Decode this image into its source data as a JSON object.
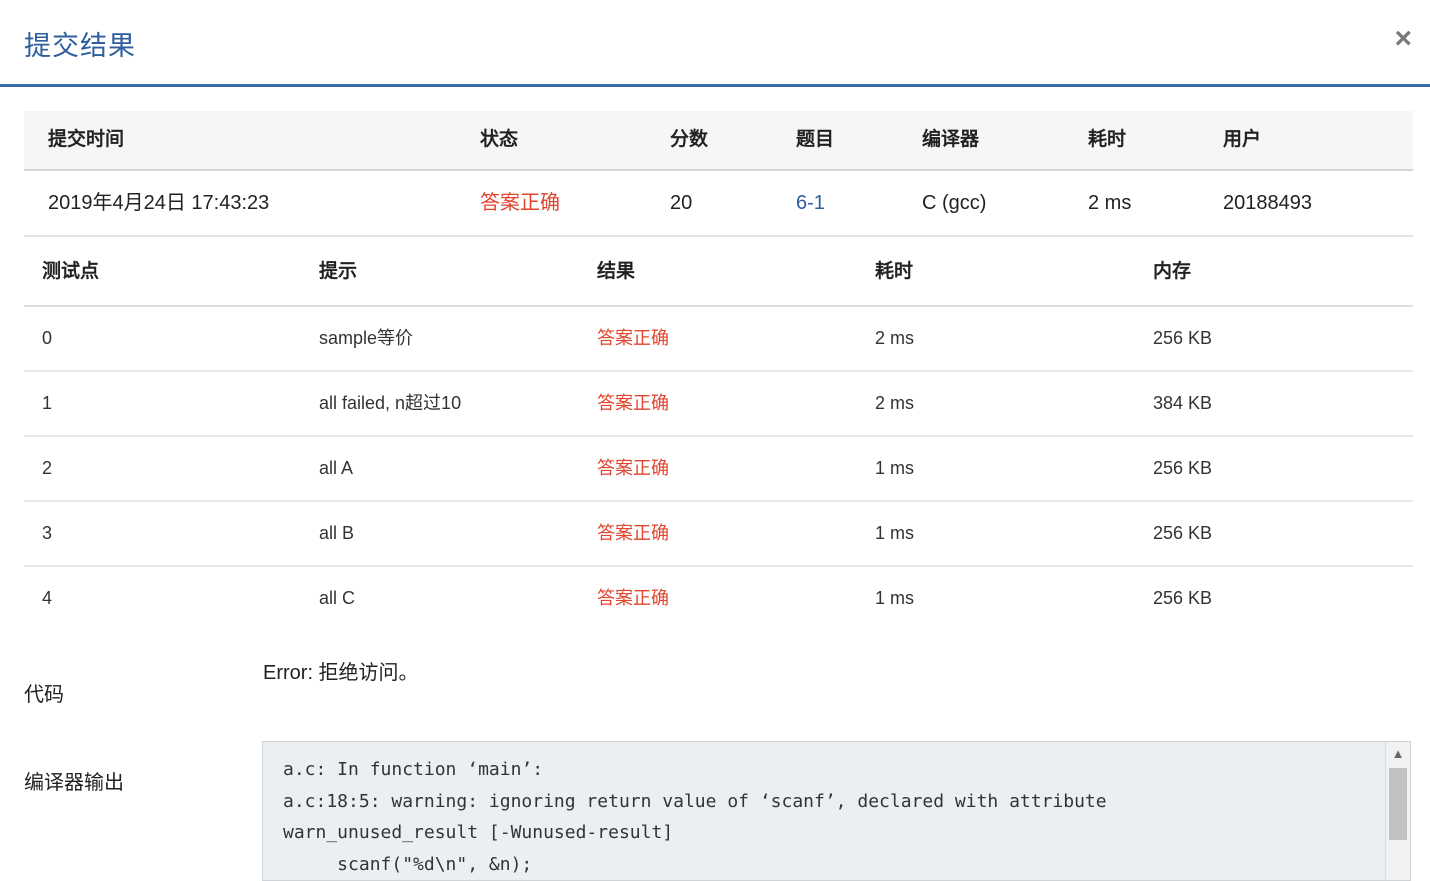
{
  "dialog": {
    "title": "提交结果",
    "close_label": "×"
  },
  "summary": {
    "headers": [
      "提交时间",
      "状态",
      "分数",
      "题目",
      "编译器",
      "耗时",
      "用户"
    ],
    "row": {
      "time": "2019年4月24日 17:43:23",
      "status": "答案正确",
      "score": "20",
      "problem": "6-1",
      "compiler": "C (gcc)",
      "duration": "2 ms",
      "user": "20188493"
    }
  },
  "tests": {
    "headers": [
      "测试点",
      "提示",
      "结果",
      "耗时",
      "内存"
    ],
    "rows": [
      {
        "id": "0",
        "hint": "sample等价",
        "result": "答案正确",
        "time": "2 ms",
        "memory": "256 KB"
      },
      {
        "id": "1",
        "hint": "all failed, n超过10",
        "result": "答案正确",
        "time": "2 ms",
        "memory": "384 KB"
      },
      {
        "id": "2",
        "hint": "all A",
        "result": "答案正确",
        "time": "1 ms",
        "memory": "256 KB"
      },
      {
        "id": "3",
        "hint": "all B",
        "result": "答案正确",
        "time": "1 ms",
        "memory": "256 KB"
      },
      {
        "id": "4",
        "hint": "all C",
        "result": "答案正确",
        "time": "1 ms",
        "memory": "256 KB"
      }
    ]
  },
  "code": {
    "label": "代码",
    "error": "Error: 拒绝访问。"
  },
  "compiler_output": {
    "label": "编译器输出",
    "lines": [
      "a.c: In function ‘main’:",
      "a.c:18:5: warning: ignoring return value of ‘scanf’, declared with attribute",
      "warn_unused_result [-Wunused-result]",
      "     scanf(\"%d\\n\", &n);"
    ]
  },
  "colors": {
    "accent": "#2e5e9e",
    "status_ok": "#e0452e",
    "header_border": "#3a6cad"
  },
  "icons": {
    "close": "close-icon",
    "scroll_up": "chevron-up-icon"
  }
}
